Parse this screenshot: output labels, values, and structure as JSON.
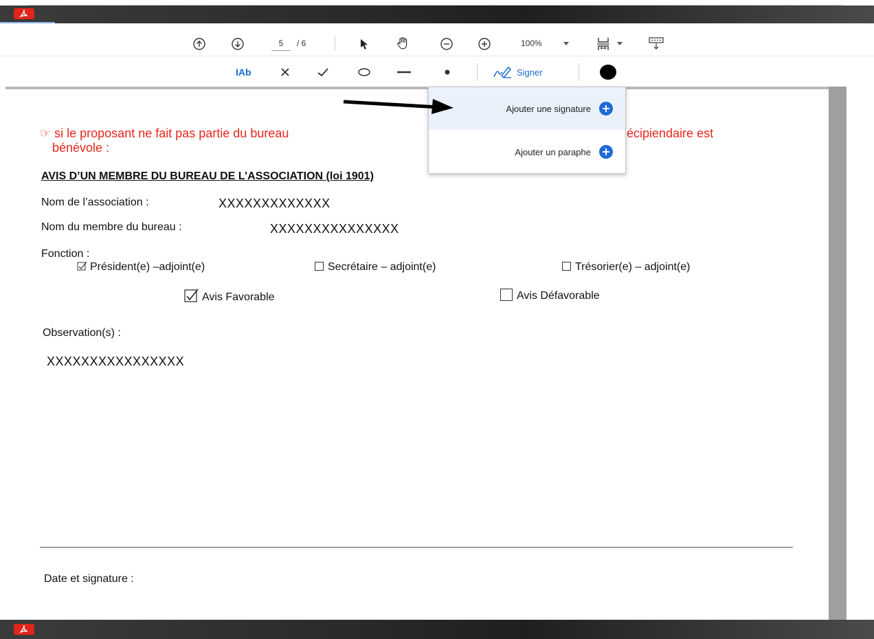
{
  "nav_toolbar": {
    "page_current": "5",
    "page_total": "/ 6",
    "zoom": "100%"
  },
  "fill_toolbar": {
    "text_tool": "IAb",
    "signer_label": "Signer"
  },
  "menu": {
    "add_signature": "Ajouter une signature",
    "add_initials": "Ajouter un paraphe"
  },
  "document": {
    "intro_line1": "☞ si le proposant ne fait pas partie du bureau",
    "intro_line1_tail": "écipiendaire est",
    "intro_line2": "bénévole :",
    "heading": "AVIS D’UN MEMBRE DU BUREAU DE L’ASSOCIATION (loi 1901)",
    "assoc_label": "Nom de l’association :",
    "assoc_value": "XXXXXXXXXXXXX",
    "member_label": "Nom du membre du bureau :",
    "member_value": "XXXXXXXXXXXXXXX",
    "function_label": "Fonction :",
    "opt_president": "Président(e) –adjoint(e)",
    "opt_secretaire": "Secrétaire – adjoint(e)",
    "opt_tresorier": "Trésorier(e) – adjoint(e)",
    "avis_favorable": "Avis Favorable",
    "avis_defavorable": "Avis Défavorable",
    "observation_label": "Observation(s) :",
    "observation_value": "XXXXXXXXXXXXXXXX",
    "date_signature": "Date et signature :"
  },
  "colors": {
    "accent": "#1f6ad6",
    "red_text": "#e8261e",
    "acrobat_red": "#e0251b"
  }
}
